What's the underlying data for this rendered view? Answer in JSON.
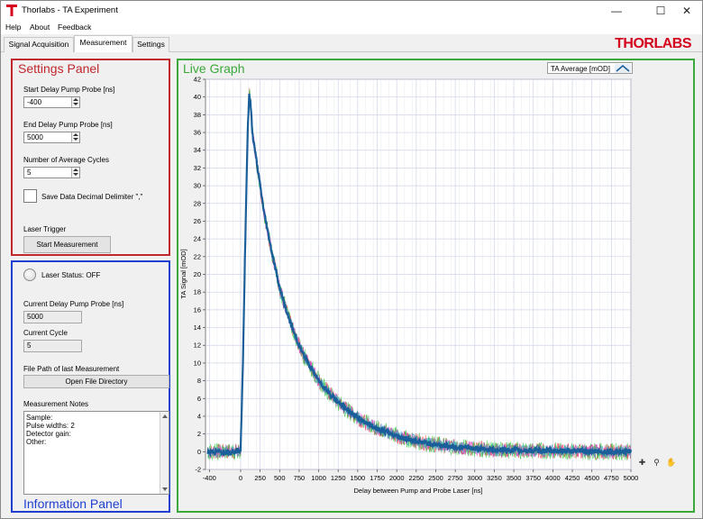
{
  "window": {
    "title": "Thorlabs - TA Experiment",
    "minimize_glyph": "—",
    "maximize_glyph": "☐",
    "close_glyph": "✕"
  },
  "menu": [
    "Help",
    "About",
    "Feedback"
  ],
  "tabs": [
    {
      "label": "Signal Acquisition",
      "active": false
    },
    {
      "label": "Measurement",
      "active": true
    },
    {
      "label": "Settings",
      "active": false
    }
  ],
  "brand": {
    "logo_text": "THORLABS",
    "color": "#d4001c"
  },
  "settings_panel": {
    "title": "Settings Panel",
    "color": "#c0282d",
    "start_delay": {
      "label": "Start Delay Pump Probe [ns]",
      "value": "-400"
    },
    "end_delay": {
      "label": "End Delay Pump Probe [ns]",
      "value": "5000"
    },
    "avg_cycles": {
      "label": "Number of Average Cycles",
      "value": "5"
    },
    "save_decimal": {
      "label": "Save Data Decimal Delimiter \",\"",
      "checked": false
    },
    "laser_trigger_label": "Laser Trigger",
    "start_button": "Start Measurement"
  },
  "info_panel": {
    "title": "Information Panel",
    "color": "#1f3fd0",
    "laser_status": "Laser Status: OFF",
    "current_delay": {
      "label": "Current Delay Pump Probe [ns]",
      "value": "5000"
    },
    "current_cycle": {
      "label": "Current Cycle",
      "value": "5"
    },
    "file_path_label": "File Path of last Measurement",
    "open_dir_button": "Open File Directory",
    "notes_label": "Measurement Notes",
    "notes_lines": [
      "Sample:",
      "Pulse widths: 2",
      "Detector gain:",
      "Other:"
    ]
  },
  "graph": {
    "title": "Live Graph",
    "color": "#3aa83a",
    "legend_label": "TA Average [mOD]",
    "tools": [
      "cursor-icon",
      "zoom-icon",
      "pan-icon"
    ],
    "tool_glyphs": [
      "✚",
      "⚲",
      "✋"
    ]
  },
  "chart_data": {
    "type": "line",
    "xlabel": "Delay between Pump and Probe Laser [ns]",
    "ylabel": "TA Signal [mOD]",
    "xlim": [
      -450,
      5000
    ],
    "ylim": [
      -2,
      42
    ],
    "x_ticks": [
      -400,
      -250,
      -150,
      0,
      150,
      250,
      375,
      500,
      625,
      750,
      875,
      1000,
      1125,
      1250,
      1375,
      1500,
      1625,
      1750,
      1875,
      2000,
      2125,
      2250,
      2375,
      2500,
      2625,
      2750,
      2875,
      3000,
      3125,
      3250,
      3375,
      3500,
      3625,
      3750,
      3875,
      4000,
      4125,
      4250,
      4375,
      4500,
      4625,
      4750,
      4875,
      5000
    ],
    "x_tick_labels": [
      "-400",
      "",
      "",
      "0",
      "",
      "250",
      "",
      "500",
      "",
      "750",
      "",
      "1000",
      "",
      "1250",
      "",
      "1500",
      "",
      "1750",
      "",
      "2000",
      "",
      "2250",
      "",
      "2500",
      "",
      "2750",
      "",
      "3000",
      "",
      "3250",
      "",
      "3500",
      "",
      "3750",
      "",
      "4000",
      "",
      "4250",
      "",
      "4500",
      "",
      "4750",
      "",
      "5000"
    ],
    "x_printed_ticks": [
      -400,
      0,
      250,
      500,
      750,
      1000,
      1250,
      1500,
      1750,
      2000,
      2250,
      2500,
      2750,
      3000,
      3250,
      3500,
      3750,
      4000,
      4250,
      4500,
      4750,
      5000
    ],
    "x_printed_tick_labels": [
      "-400",
      "0",
      "250",
      "500",
      "750",
      "1000",
      "1250",
      "1500",
      "1750",
      "2000",
      "2250",
      "2500",
      "2750",
      "3000",
      "3250",
      "3500",
      "3750",
      "4000",
      "4250",
      "4500",
      "4750",
      "5000"
    ],
    "x_minor_ticks": [
      -300,
      -200,
      -100,
      100,
      200,
      300,
      400,
      600,
      700,
      800,
      900,
      1100,
      1200,
      1300,
      1400,
      1600,
      1700,
      1800,
      1900,
      2100,
      2200,
      2300,
      2400,
      2600,
      2700,
      2800,
      2900,
      3100,
      3200,
      3300,
      3400,
      3600,
      3700,
      3800,
      3900,
      4100,
      4200,
      4300,
      4400,
      4600,
      4700,
      4800,
      4900
    ],
    "y_ticks": [
      -2,
      0,
      2,
      4,
      6,
      8,
      10,
      12,
      14,
      16,
      18,
      20,
      22,
      24,
      26,
      28,
      30,
      32,
      34,
      36,
      38,
      40,
      42
    ],
    "grid": true,
    "series": [
      {
        "name": "TA Average [mOD]",
        "color": "#1b5f9a",
        "x": [
          -400,
          -300,
          -200,
          -100,
          0,
          30,
          60,
          90,
          110,
          130,
          150,
          200,
          250,
          300,
          400,
          500,
          600,
          700,
          800,
          900,
          1000,
          1100,
          1200,
          1300,
          1400,
          1500,
          1700,
          1900,
          2100,
          2300,
          2500,
          2700,
          3000,
          3300,
          3600,
          4000,
          4400,
          4800,
          5000
        ],
        "y": [
          0,
          0,
          0,
          0,
          0.2,
          10,
          24,
          36,
          40.5,
          39,
          36,
          33,
          30,
          27,
          22.5,
          18.5,
          15.5,
          13,
          11,
          9.5,
          8,
          7,
          6,
          5.2,
          4.5,
          3.8,
          2.8,
          2.1,
          1.5,
          1.1,
          0.8,
          0.6,
          0.35,
          0.2,
          0.15,
          0.1,
          0.05,
          0,
          0
        ]
      }
    ]
  }
}
